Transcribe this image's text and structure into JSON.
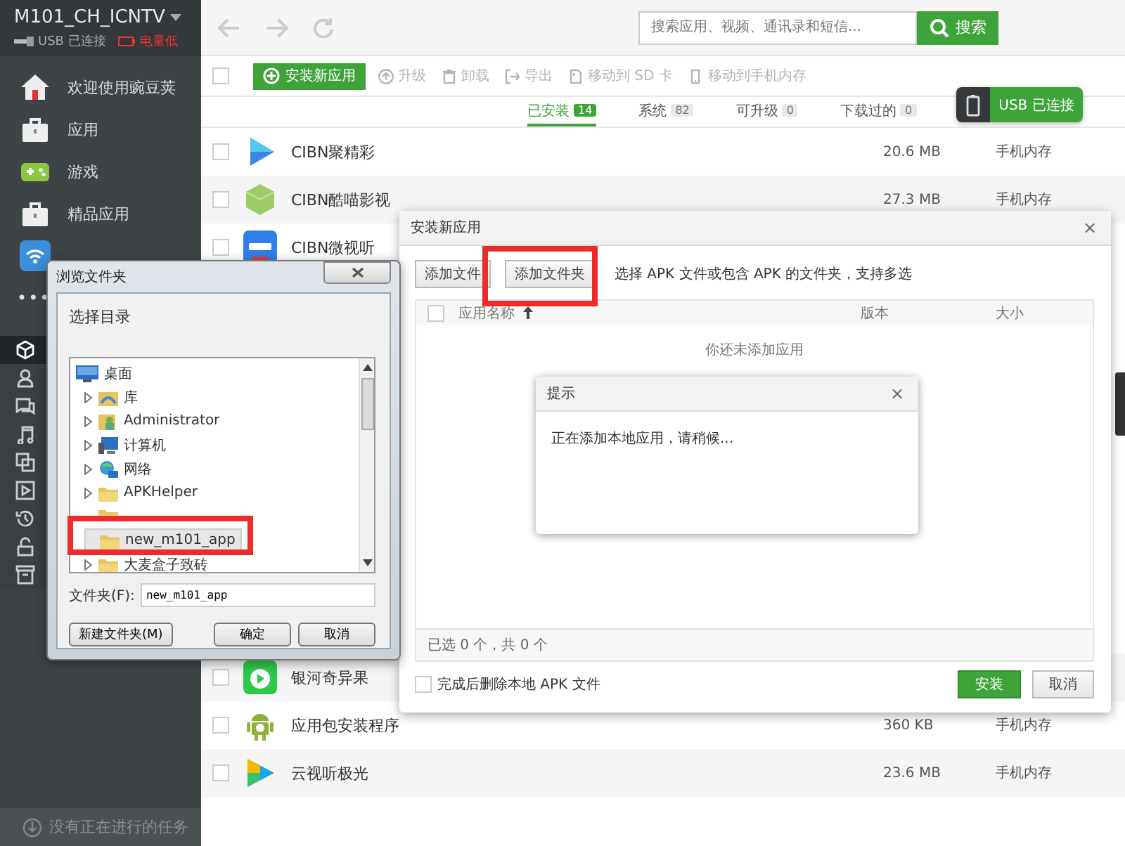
{
  "sidebar": {
    "device": "M101_CH_ICNTV",
    "usb_status": "USB 已连接",
    "battery_status": "电量低",
    "items": [
      {
        "label": "欢迎使用豌豆荚",
        "kind": "home"
      },
      {
        "label": "应用",
        "kind": "bag"
      },
      {
        "label": "游戏",
        "kind": "game"
      },
      {
        "label": "精品应用",
        "kind": "bag"
      },
      {
        "kind": "wifi"
      }
    ],
    "more": "•••",
    "tools": [
      {
        "kind": "cube",
        "selected": true
      },
      {
        "kind": "person",
        "selected": false
      },
      {
        "kind": "chat",
        "selected": false
      },
      {
        "kind": "music",
        "selected": false
      },
      {
        "kind": "copy",
        "selected": false
      },
      {
        "kind": "play",
        "selected": false
      },
      {
        "kind": "history",
        "selected": false
      },
      {
        "kind": "unlock",
        "selected": false
      },
      {
        "kind": "archive",
        "selected": false
      }
    ],
    "task_status": "没有正在进行的任务"
  },
  "search": {
    "placeholder": "搜索应用、视频、通讯录和短信...",
    "button": "搜索"
  },
  "toolbar": {
    "select_all_checked": false,
    "install_button": "安装新应用",
    "actions": [
      {
        "label": "升级",
        "kind": "upgrade",
        "disabled": true
      },
      {
        "label": "卸载",
        "kind": "trash",
        "disabled": true
      },
      {
        "label": "导出",
        "kind": "export",
        "disabled": true
      },
      {
        "label": "移动到 SD 卡",
        "kind": "sd",
        "disabled": true
      },
      {
        "label": "移动到手机内存",
        "kind": "phone",
        "disabled": true
      }
    ]
  },
  "tabs": [
    {
      "label": "已安装",
      "count": "14",
      "selected": true
    },
    {
      "label": "系统",
      "count": "82",
      "selected": false
    },
    {
      "label": "可升级",
      "count": "0",
      "selected": false
    },
    {
      "label": "下载过的",
      "count": "0",
      "selected": false
    }
  ],
  "usb_badge": "USB 已连接",
  "apps": [
    {
      "name": "CIBN聚精彩",
      "kind": "play-blue",
      "size": "20.6 MB",
      "location": "手机内存",
      "checked": false
    },
    {
      "name": "CIBN酷喵影视",
      "kind": "cube-green",
      "size": "27.3 MB",
      "location": "手机内存",
      "checked": false
    },
    {
      "name": "CIBN微视听",
      "kind": "tile-blue",
      "checked": false
    },
    {
      "name": "银河奇异果",
      "kind": "tv-green",
      "checked": false
    },
    {
      "name": "应用包安装程序",
      "kind": "android",
      "size": "360 KB",
      "location": "手机内存",
      "checked": false
    },
    {
      "name": "云视听极光",
      "kind": "play-gradient",
      "size": "23.6 MB",
      "location": "手机内存",
      "checked": false
    }
  ],
  "install_dialog": {
    "title": "安装新应用",
    "close": "×",
    "add_file": "添加文件",
    "add_folder": "添加文件夹",
    "hint": "选择 APK 文件或包含 APK 的文件夹，支持多选",
    "columns": [
      "应用名称",
      "版本",
      "大小"
    ],
    "header_checked": false,
    "empty": "你还未添加应用",
    "summary": "已选 0 个，共 0 个",
    "delete_after": {
      "label": "完成后删除本地 APK 文件",
      "checked": false
    },
    "install": "安装",
    "cancel": "取消"
  },
  "hint_dialog": {
    "title": "提示",
    "close": "×",
    "message": "正在添加本地应用，请稍候..."
  },
  "folder_dialog": {
    "title": "浏览文件夹",
    "prompt": "选择目录",
    "tree": {
      "label": "桌面",
      "kind": "desktop",
      "selected": false,
      "children": [
        {
          "label": "库",
          "kind": "library",
          "expandable": true,
          "selected": false
        },
        {
          "label": "Administrator",
          "kind": "user",
          "expandable": true,
          "selected": false
        },
        {
          "label": "计算机",
          "kind": "computer",
          "expandable": true,
          "selected": false
        },
        {
          "label": "网络",
          "kind": "network",
          "expandable": true,
          "selected": false
        },
        {
          "label": "APKHelper",
          "kind": "folder",
          "expandable": true,
          "selected": false
        },
        {
          "kind": "folder",
          "expandable": false,
          "selected": false
        },
        {
          "label": "new_m101_app",
          "kind": "folder",
          "expandable": false,
          "selected": true
        },
        {
          "label": "大麦盒子致砖",
          "kind": "folder",
          "expandable": true,
          "selected": false
        }
      ]
    },
    "folder_label": "文件夹(F):",
    "folder_value": "new_m101_app",
    "new_folder": "新建文件夹(M)",
    "ok": "确定",
    "cancel": "取消"
  }
}
